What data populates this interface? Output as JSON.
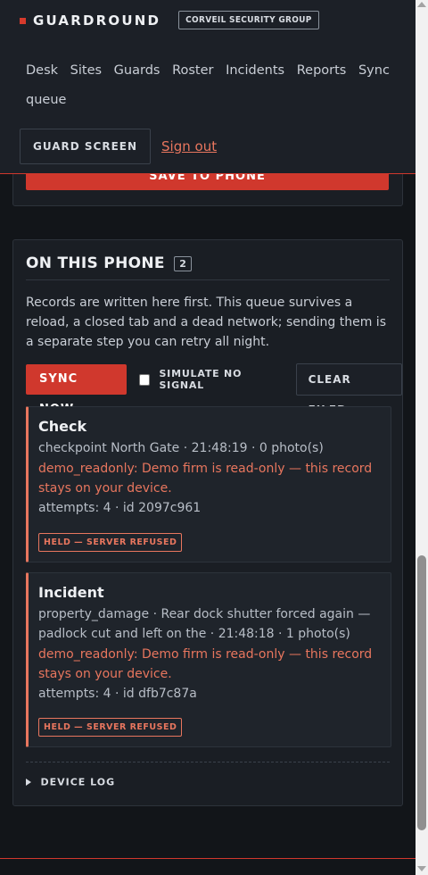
{
  "header": {
    "brand": "GUARDROUND",
    "org": "CORVEIL SECURITY GROUP",
    "nav": [
      "Desk",
      "Sites",
      "Guards",
      "Roster",
      "Incidents",
      "Reports",
      "Sync queue"
    ],
    "guard_screen": "GUARD SCREEN",
    "sign_out": "Sign out"
  },
  "form": {
    "save_label": "SAVE TO PHONE"
  },
  "queue": {
    "title": "ON THIS PHONE",
    "count": "2",
    "description": "Records are written here first. This queue survives a reload, a closed tab and a dead network; sending them is a separate step you can retry all night.",
    "sync_now": "SYNC NOW",
    "simulate_no_signal": "SIMULATE NO SIGNAL",
    "clear_filed": "CLEAR FILED",
    "records": [
      {
        "title": "Check",
        "meta": "checkpoint North Gate · 21:48:19 · 0 photo(s)",
        "error": "demo_readonly: Demo firm is read-only — this record stays on your device.",
        "attempts": "attempts: 4 · id 2097c961",
        "badge": "HELD — SERVER REFUSED"
      },
      {
        "title": "Incident",
        "meta": "property_damage · Rear dock shutter forced again — padlock cut and left on the · 21:48:18 · 1 photo(s)",
        "error": "demo_readonly: Demo firm is read-only — this record stays on your device.",
        "attempts": "attempts: 4 · id dfb7c87a",
        "badge": "HELD — SERVER REFUSED"
      }
    ],
    "device_log": "DEVICE LOG"
  },
  "colors": {
    "accent": "#d0382d",
    "warn": "#e8765e",
    "background": "#121519",
    "card": "#1a1e24"
  },
  "icons": {
    "brand_mark": "red-square",
    "device_log_toggle": "triangle-right"
  }
}
